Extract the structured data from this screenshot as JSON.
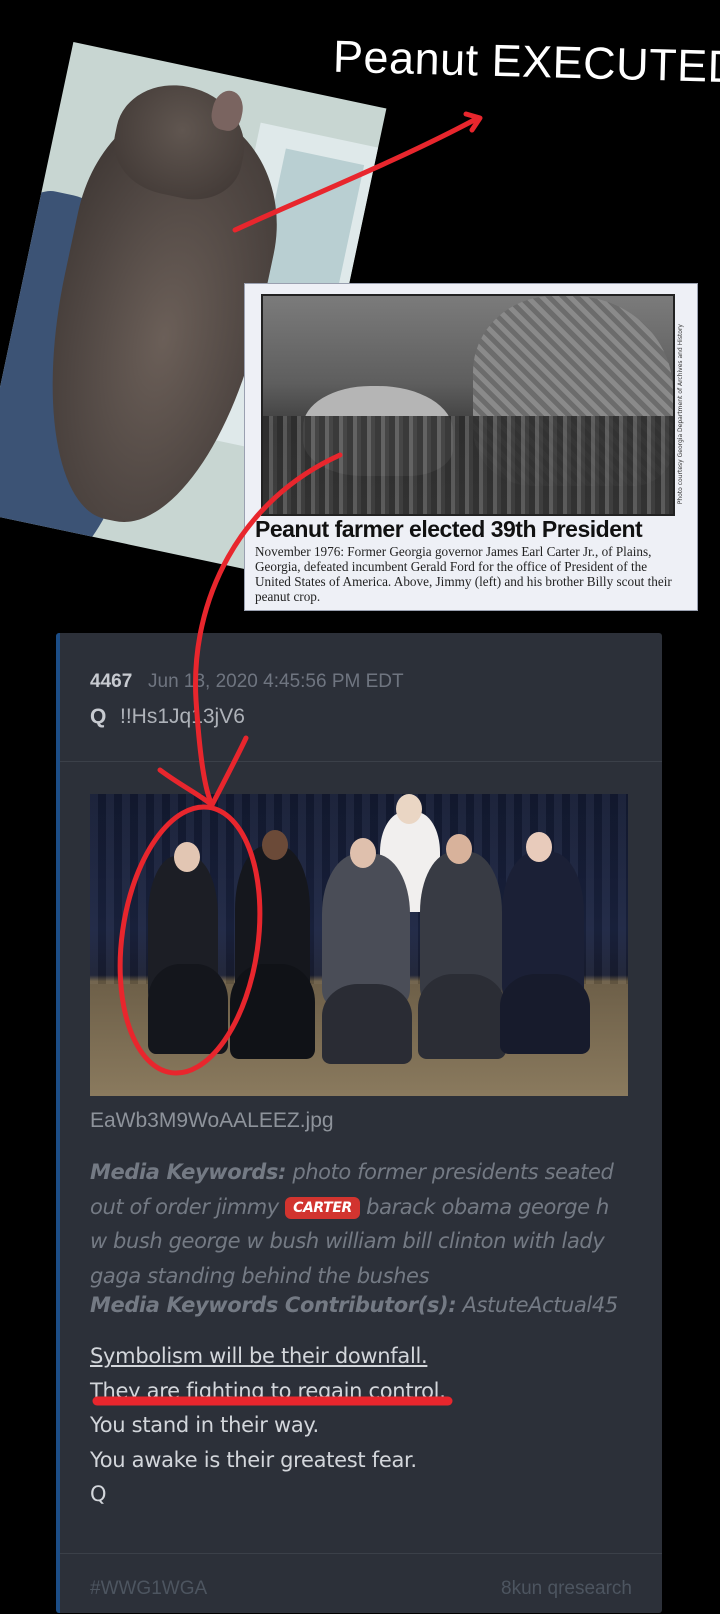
{
  "caption": "Peanut EXECUTED",
  "clipping": {
    "headline": "Peanut farmer elected 39th President",
    "body": "November 1976: Former Georgia governor James Earl Carter Jr., of Plains, Georgia, defeated incumbent Gerald Ford for the office of President of the United States of America. Above, Jimmy (left) and his brother Billy scout their peanut crop.",
    "credit": "Photo courtesy Georgia Department of Archives and History"
  },
  "post": {
    "number": "4467",
    "date": "Jun 13, 2020 4:45:56 PM EDT",
    "author": "Q",
    "tripcode": "!!Hs1Jq13jV6",
    "filename": "EaWb3M9WoAALEEZ.jpg",
    "keywords_label": "Media Keywords:",
    "keywords_pre": "photo former presidents seated out of order jimmy",
    "keywords_tag": "CARTER",
    "keywords_post": "barack obama george h w bush george w bush william bill clinton with lady gaga standing behind the bushes",
    "contributor_label": "Media Keywords Contributor(s):",
    "contributor": "AstuteActual45",
    "lines": [
      "Symbolism will be their downfall.",
      "They are fighting to regain control.",
      "You stand in their way.",
      "You awake is their greatest fear.",
      "Q"
    ],
    "hashtag": "#WWG1WGA",
    "board": "8kun qresearch"
  },
  "colors": {
    "background": "#000000",
    "card": "#2c3039",
    "annotation_red": "#e8262d",
    "tag_red": "#d2342f"
  }
}
